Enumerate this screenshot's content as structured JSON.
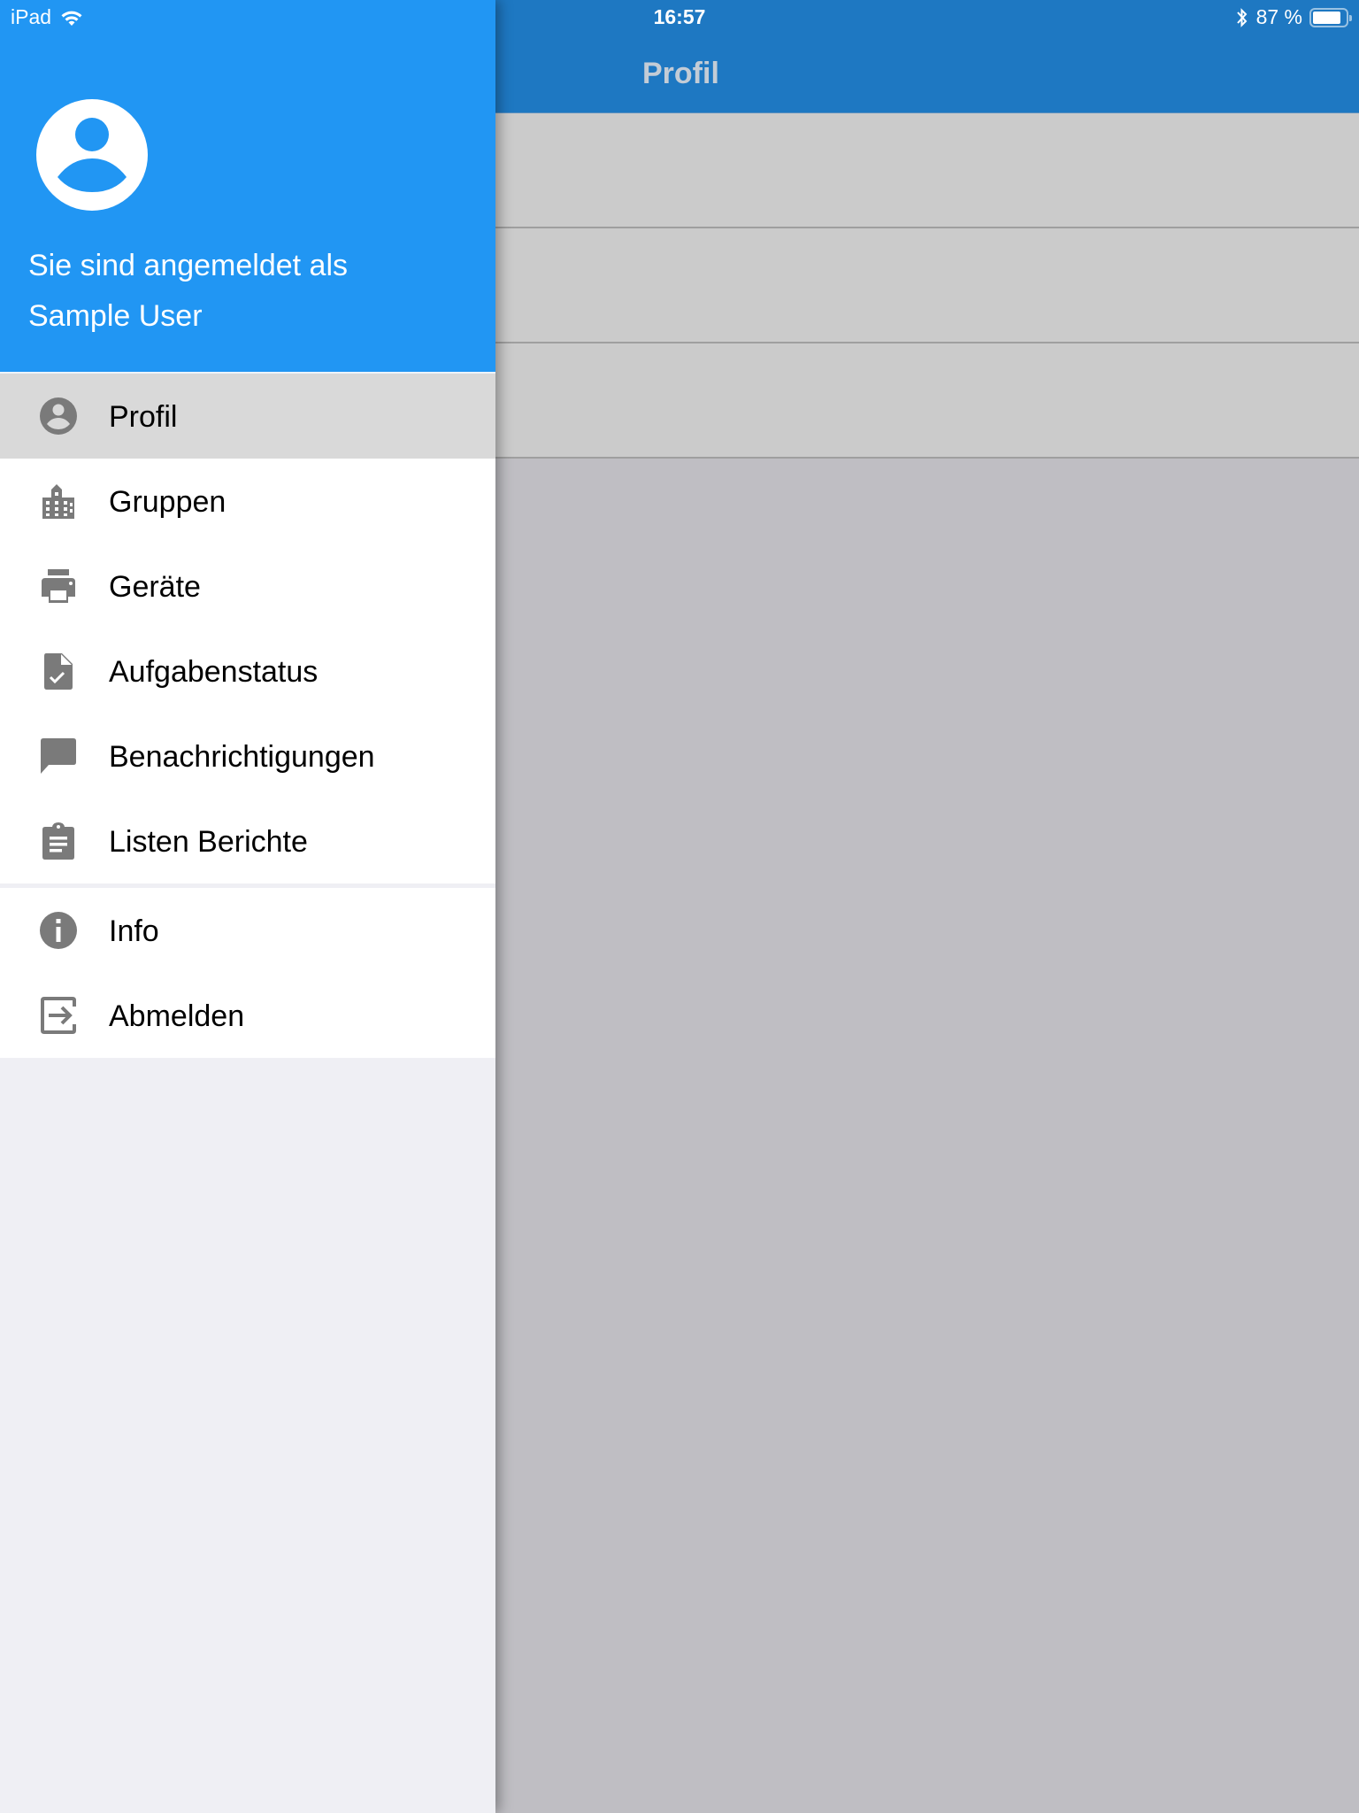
{
  "status_bar": {
    "device": "iPad",
    "time": "16:57",
    "battery_percent_label": "87 %",
    "battery_level": 0.87,
    "icons": [
      "wifi-icon",
      "bluetooth-icon",
      "battery-icon"
    ]
  },
  "nav_bar": {
    "title": "Profil"
  },
  "content": {
    "row_count": 3
  },
  "drawer": {
    "header": {
      "avatar_icon": "account-circle-icon",
      "logged_in_label": "Sie sind angemeldet als",
      "user_name": "Sample User"
    },
    "menu_primary": [
      {
        "label": "Profil",
        "icon": "account-circle-icon",
        "active": true
      },
      {
        "label": "Gruppen",
        "icon": "building-icon",
        "active": false
      },
      {
        "label": "Geräte",
        "icon": "printer-icon",
        "active": false
      },
      {
        "label": "Aufgabenstatus",
        "icon": "file-check-icon",
        "active": false
      },
      {
        "label": "Benachrichtigungen",
        "icon": "message-icon",
        "active": false
      },
      {
        "label": "Listen Berichte",
        "icon": "clipboard-text-icon",
        "active": false
      }
    ],
    "menu_secondary": [
      {
        "label": "Info",
        "icon": "info-icon",
        "active": false
      },
      {
        "label": "Abmelden",
        "icon": "logout-icon",
        "active": false
      }
    ]
  },
  "colors": {
    "drawer_header": "#2196f3",
    "nav_bar": "#1e78c2",
    "active_item": "#d9d9d9",
    "icon_gray": "#7a7a7a",
    "drawer_background": "#efeff4",
    "overlay_background": "#bfbec3"
  }
}
